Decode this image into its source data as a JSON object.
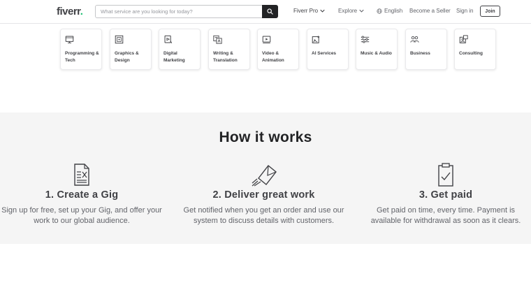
{
  "header": {
    "logo_text": "fiverr",
    "logo_dot": ".",
    "search_placeholder": "What service are you looking for today?",
    "nav": {
      "fiverr_pro": "Fiverr Pro",
      "explore": "Explore",
      "language": "English",
      "become_seller": "Become a Seller",
      "sign_in": "Sign in",
      "join": "Join"
    }
  },
  "categories": [
    {
      "label": "Programming & Tech",
      "icon": "monitor-icon"
    },
    {
      "label": "Graphics & Design",
      "icon": "design-icon"
    },
    {
      "label": "Digital Marketing",
      "icon": "marketing-icon"
    },
    {
      "label": "Writing & Translation",
      "icon": "translation-icon"
    },
    {
      "label": "Video & Animation",
      "icon": "video-icon"
    },
    {
      "label": "AI Services",
      "icon": "ai-icon"
    },
    {
      "label": "Music & Audio",
      "icon": "music-icon"
    },
    {
      "label": "Business",
      "icon": "business-icon"
    },
    {
      "label": "Consulting",
      "icon": "consulting-icon"
    }
  ],
  "how_it_works": {
    "title": "How it works",
    "steps": [
      {
        "title": "1. Create a Gig",
        "description": "Sign up for free, set up your Gig, and offer your work to our global audience.",
        "icon": "document-icon"
      },
      {
        "title": "2. Deliver great work",
        "description": "Get notified when you get an order and use our system to discuss details with customers.",
        "icon": "envelope-icon"
      },
      {
        "title": "3. Get paid",
        "description": "Get paid on time, every time. Payment is available for withdrawal as soon as it clears.",
        "icon": "clipboard-check-icon"
      }
    ]
  },
  "colors": {
    "brand_green": "#1dbf73",
    "text_dark": "#404145",
    "section_bg": "#f5f5f5"
  }
}
